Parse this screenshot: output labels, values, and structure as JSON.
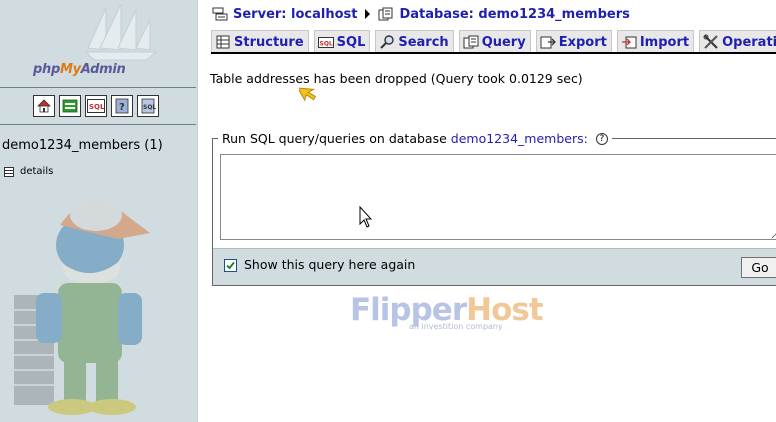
{
  "nav": {
    "logo": {
      "php": "php",
      "my": "My",
      "admin": "Admin"
    },
    "icons": [
      {
        "name": "home-icon",
        "glyph": "home"
      },
      {
        "name": "query-window-icon",
        "glyph": "exit"
      },
      {
        "name": "sql-icon",
        "glyph": "SQL"
      },
      {
        "name": "docs-icon",
        "glyph": "help"
      },
      {
        "name": "sql-docs-icon",
        "glyph": "docs"
      }
    ],
    "database_label": "demo1234_members (1)",
    "tables": [
      {
        "label": "details"
      }
    ]
  },
  "breadcrumb": {
    "server": "Server: localhost",
    "database": "Database: demo1234_members"
  },
  "tabs": [
    {
      "name": "tab-structure",
      "label": "Structure",
      "icon": "structure-icon"
    },
    {
      "name": "tab-sql",
      "label": "SQL",
      "icon": "sql-icon"
    },
    {
      "name": "tab-search",
      "label": "Search",
      "icon": "search-icon"
    },
    {
      "name": "tab-query",
      "label": "Query",
      "icon": "query-icon"
    },
    {
      "name": "tab-export",
      "label": "Export",
      "icon": "export-icon"
    },
    {
      "name": "tab-import",
      "label": "Import",
      "icon": "import-icon"
    },
    {
      "name": "tab-operations",
      "label": "Operations",
      "icon": "operations-icon"
    }
  ],
  "message": "Table addresses has been dropped (Query took 0.0129 sec)",
  "sql_form": {
    "legend_prefix": "Run SQL query/queries on database",
    "legend_db": "demo1234_members:",
    "query_value": "",
    "show_again_label": "Show this query here again",
    "show_again_checked": true,
    "go_label": "Go"
  },
  "watermark": {
    "brand_flipper": "Flipper",
    "brand_host": "Host",
    "tagline": "an investition company"
  },
  "colors": {
    "link": "#1f1fb0",
    "nav_bg": "#d0dce0",
    "tab_bg": "#e8e8e8"
  }
}
